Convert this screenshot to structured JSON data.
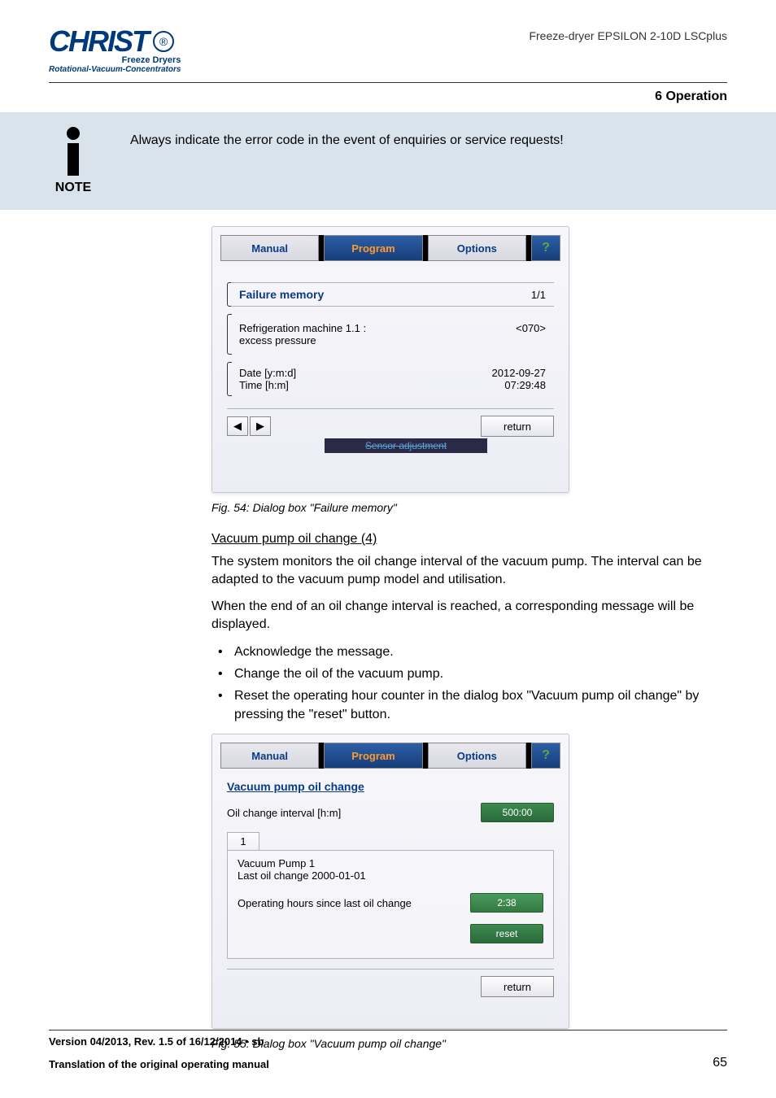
{
  "header": {
    "logo_main": "CHRIST",
    "logo_sub1": "Freeze Dryers",
    "logo_sub2": "Rotational-Vacuum-Concentrators",
    "product": "Freeze-dryer EPSILON 2-10D LSCplus"
  },
  "section_title": "6 Operation",
  "note": {
    "label": "NOTE",
    "text": "Always indicate the error code in the event of enquiries or service requests!"
  },
  "dialog1": {
    "tabs": {
      "manual": "Manual",
      "program": "Program",
      "options": "Options",
      "q": "?"
    },
    "title": "Failure memory",
    "count": "1/1",
    "row1_l": "Refrigeration machine 1.1 :\nexcess pressure",
    "row1_r": "<070>",
    "date_l": "Date [y:m:d]",
    "date_r": "2012-09-27",
    "time_l": "Time [h:m]",
    "time_r": "07:29:48",
    "return": "return",
    "strip": "Sensor adjustment"
  },
  "fig1": "Fig. 54: Dialog box \"Failure memory\"",
  "vp_head": "Vacuum pump oil change (4)",
  "vp_p1": "The system monitors the oil change interval of the vacuum pump. The interval can be adapted to the vacuum pump model and utilisation.",
  "vp_p2": "When the end of an oil change interval is reached, a corresponding message will be displayed.",
  "vp_bul": [
    "Acknowledge the message.",
    "Change the oil of the vacuum pump.",
    "Reset the operating hour counter in the dialog box \"Vacuum pump oil change\" by pressing the \"reset\" button."
  ],
  "dialog2": {
    "title": "Vacuum pump oil change",
    "interval_l": "Oil change interval [h:m]",
    "interval_v": "500:00",
    "tab1": "1",
    "vp1": "Vacuum Pump 1",
    "last": "Last oil change 2000-01-01",
    "op_l": "Operating hours since last oil change",
    "op_v": "2:38",
    "reset": "reset",
    "return": "return"
  },
  "fig2": "Fig. 55: Dialog box \"Vacuum pump oil change\"",
  "footer": {
    "l1": "Version 04/2013, Rev. 1.5 of 16/12/2014 • sb",
    "l2": "Translation of the original operating manual",
    "page": "65"
  }
}
